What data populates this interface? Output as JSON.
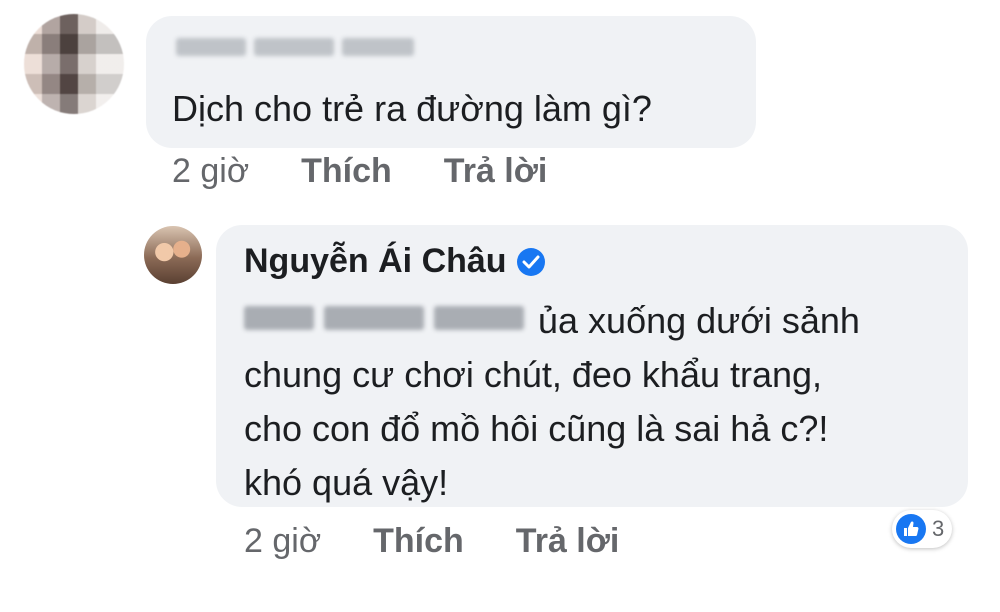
{
  "comment": {
    "text": "Dịch cho trẻ ra đường làm gì?",
    "actions": {
      "time": "2 giờ",
      "like": "Thích",
      "reply": "Trả lời"
    }
  },
  "reply": {
    "author": "Nguyễn Ái Châu",
    "lines": [
      "ủa xuống dưới sảnh",
      "chung cư chơi chút, đeo khẩu trang,",
      "cho con đổ mồ hôi cũng là sai hả c?!",
      "khó quá vậy!"
    ],
    "actions": {
      "time": "2 giờ",
      "like": "Thích",
      "reply": "Trả lời"
    },
    "reactions": {
      "icon": "like-icon",
      "count": "3"
    }
  },
  "colors": {
    "bubble": "#f0f2f5",
    "text": "#1c1e21",
    "meta": "#65676b",
    "accent": "#1877f2"
  }
}
